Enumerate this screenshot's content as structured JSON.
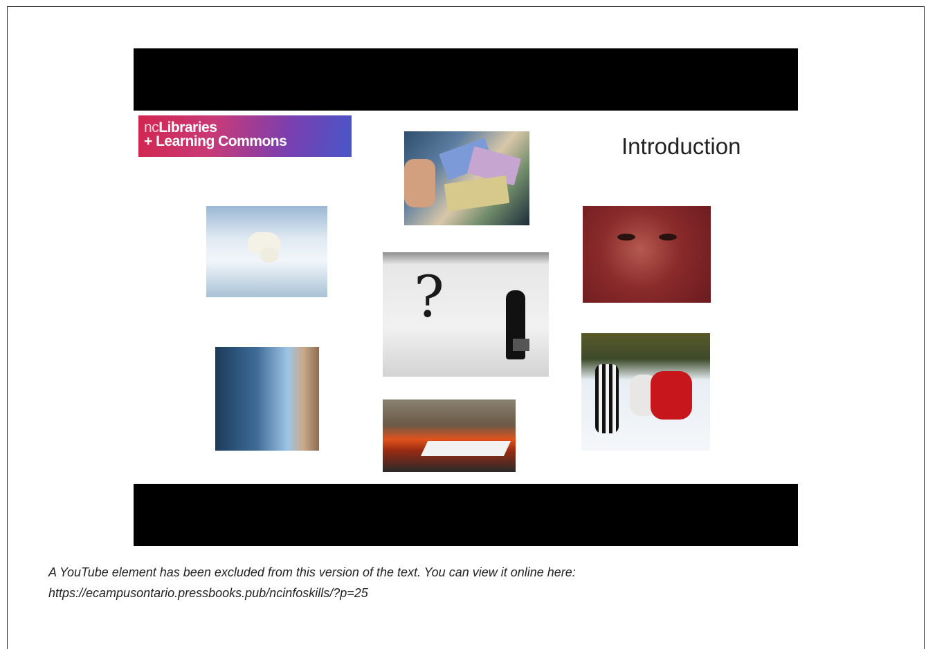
{
  "video": {
    "logo_line1_nc": "nc",
    "logo_line1_rest": "Libraries",
    "logo_line2": "+ Learning Commons",
    "slide_title": "Introduction"
  },
  "caption": {
    "line1": "A YouTube element has been excluded from this version of the text. You can view it online here:",
    "line2": "https://ecampusontario.pressbooks.pub/ncinfoskills/?p=25"
  },
  "colors": {
    "video_bg": "#000000",
    "logo_gradient_start": "#d1264f",
    "logo_gradient_end": "#4857c9"
  }
}
